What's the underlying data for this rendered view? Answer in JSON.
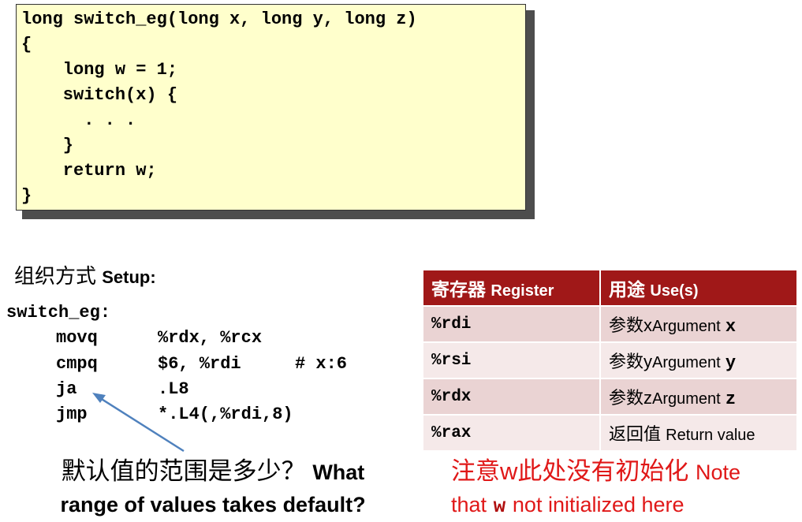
{
  "c_code": {
    "lines": [
      "long switch_eg(long x, long y, long z)",
      "{",
      "    long w = 1;",
      "    switch(x) {",
      "      . . .",
      "    }",
      "    return w;",
      "}"
    ]
  },
  "setup": {
    "label_cn": "组织方式",
    "label_en": "Setup:"
  },
  "assembly": {
    "function_label": "switch_eg:",
    "rows": [
      {
        "op": "movq",
        "args": "%rdx, %rcx",
        "comment": ""
      },
      {
        "op": "cmpq",
        "args": "$6, %rdi",
        "comment": "# x:6"
      },
      {
        "op": "ja",
        "args": ".L8",
        "comment": ""
      },
      {
        "op": "jmp",
        "args": "*.L4(,%rdi,8)",
        "comment": ""
      }
    ]
  },
  "register_table": {
    "header": {
      "col1_cn": "寄存器",
      "col1_en": "Register",
      "col2_cn": "用途",
      "col2_en": "Use(s)"
    },
    "rows": [
      {
        "reg": "%rdi",
        "use_cn": "参数x",
        "use_en": "Argument",
        "use_var": "x"
      },
      {
        "reg": "%rsi",
        "use_cn": "参数y",
        "use_en": "Argument",
        "use_var": "y"
      },
      {
        "reg": "%rdx",
        "use_cn": "参数z",
        "use_en": "Argument",
        "use_var": "z"
      },
      {
        "reg": "%rax",
        "use_cn": "返回值",
        "use_en": "Return value",
        "use_var": ""
      }
    ]
  },
  "question": {
    "cn": "默认值的范围是多少？",
    "en_line1": "What",
    "en_line2": "range of values takes default?"
  },
  "note": {
    "cn": "注意w此处没有初始化",
    "en_a": "Note",
    "en_b": "that",
    "w": "w",
    "en_c": "not initialized here"
  },
  "colors": {
    "code_bg": "#ffffcc",
    "table_header": "#a01818",
    "note_red": "#e01818",
    "arrow_blue": "#4f81bd"
  }
}
